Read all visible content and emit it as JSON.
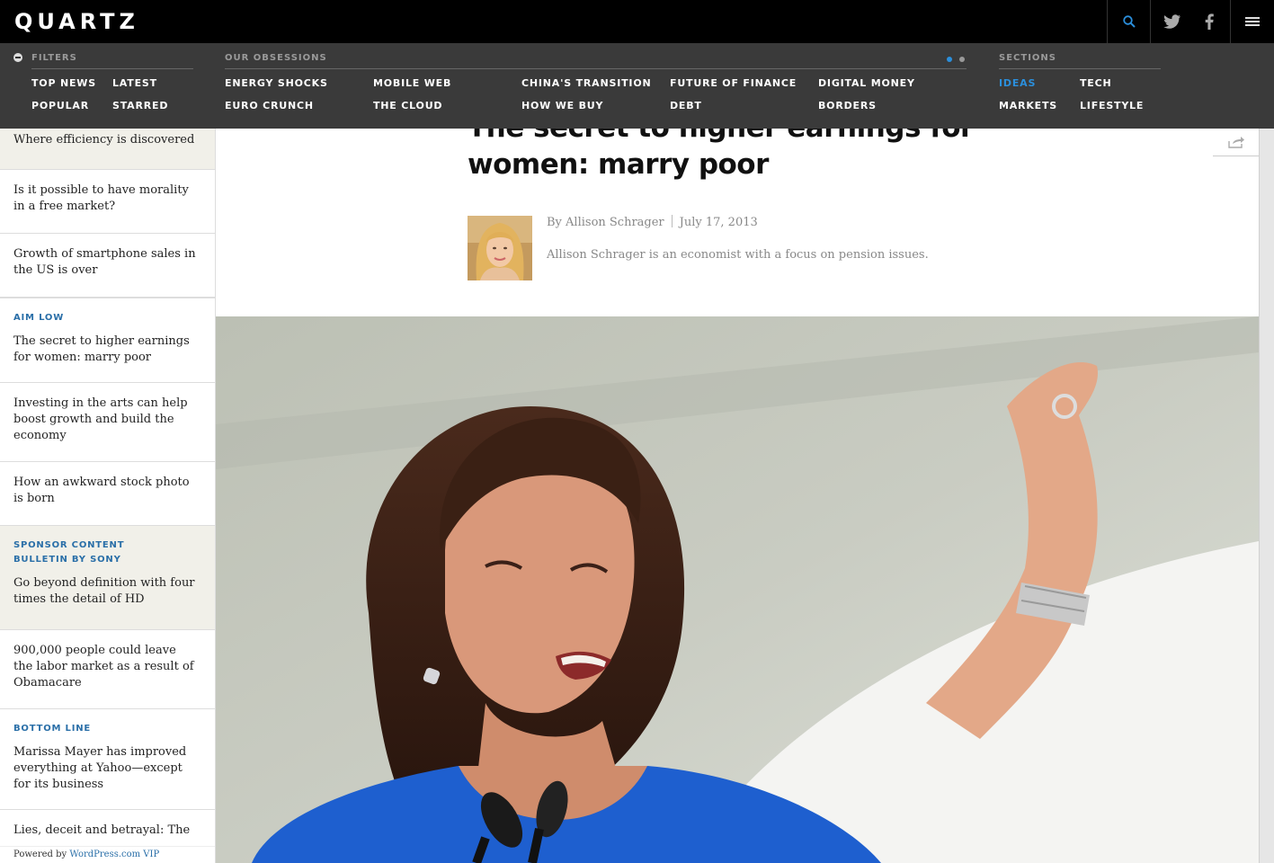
{
  "header": {
    "logo": "QUARTZ"
  },
  "icons": {
    "search": "search-icon",
    "twitter": "twitter-icon",
    "facebook": "facebook-icon",
    "menu": "hamburger-menu-icon",
    "share": "share-icon",
    "filters": "minus-circle-icon"
  },
  "colors": {
    "accent": "#2b8fdc",
    "nav_bg": "#3a3a3a",
    "kicker": "#2a6fa8",
    "sponsor_bg": "#f1f0e9"
  },
  "nav": {
    "filters": {
      "heading": "FILTERS",
      "links": [
        "TOP NEWS",
        "LATEST",
        "POPULAR",
        "STARRED"
      ]
    },
    "obsessions": {
      "heading": "OUR OBSESSIONS",
      "links": [
        "ENERGY SHOCKS",
        "MOBILE WEB",
        "CHINA'S TRANSITION",
        "FUTURE OF FINANCE",
        "DIGITAL MONEY",
        "EURO CRUNCH",
        "THE CLOUD",
        "HOW WE BUY",
        "DEBT",
        "BORDERS"
      ]
    },
    "sections": {
      "heading": "SECTIONS",
      "links": [
        "IDEAS",
        "TECH",
        "MARKETS",
        "LIFESTYLE"
      ],
      "active": "IDEAS"
    }
  },
  "sidebar": {
    "items": [
      {
        "kicker": "",
        "title": "Where efficiency is discovered"
      },
      {
        "kicker": "",
        "title": "Is it possible to have morality in a free market?"
      },
      {
        "kicker": "",
        "title": "Growth of smartphone sales in the US is over"
      },
      {
        "kicker": "AIM LOW",
        "title": "The secret to higher earnings for women: marry poor"
      },
      {
        "kicker": "",
        "title": "Investing in the arts can help boost growth and build the economy"
      },
      {
        "kicker": "",
        "title": "How an awkward stock photo is born"
      },
      {
        "kicker": "SPONSOR CONTENT",
        "kicker2": "BULLETIN BY SONY",
        "title": "Go beyond definition with four times the detail of HD"
      },
      {
        "kicker": "",
        "title": "900,000 people could leave the labor market as a result of Obamacare"
      },
      {
        "kicker": "BOTTOM LINE",
        "title": "Marissa Mayer has improved everything at Yahoo—except for its business"
      },
      {
        "kicker": "",
        "title": "Lies, deceit and betrayal: The"
      }
    ],
    "powered_prefix": "Powered by",
    "powered_link": "WordPress.com VIP"
  },
  "article": {
    "headline": "The secret to higher earnings for women: marry poor",
    "author": "By Allison Schrager",
    "date": "July 17, 2013",
    "bio": "Allison Schrager is an economist with a focus on pension issues."
  }
}
